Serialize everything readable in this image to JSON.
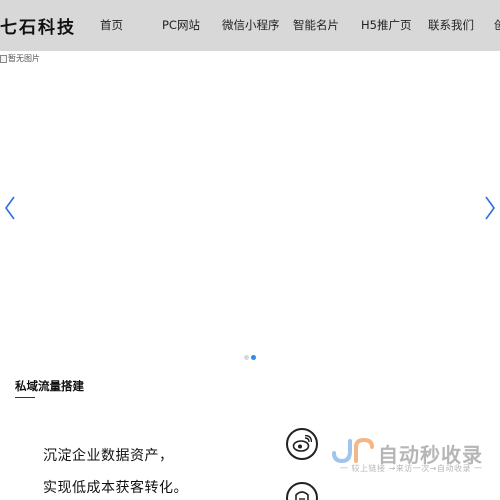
{
  "header": {
    "logo": "七石科技",
    "nav": [
      {
        "label": "首页"
      },
      {
        "label": "PC网站"
      },
      {
        "label": "微信小程序"
      },
      {
        "label": "智能名片"
      },
      {
        "label": "H5推广页"
      },
      {
        "label": "联系我们"
      },
      {
        "label": "创"
      }
    ]
  },
  "banner": {
    "image_alt": "暂无图片",
    "prev_icon": "chevron-left-icon",
    "next_icon": "chevron-right-icon",
    "dots": [
      {
        "active": false,
        "color": "#cfd8e3"
      },
      {
        "active": true,
        "color": "#2f8de4"
      }
    ]
  },
  "section": {
    "title": "私域流量搭建"
  },
  "slogan": {
    "lines": [
      "沉淀企业数据资产，",
      "实现低成本获客转化。"
    ]
  },
  "icons": [
    "weibo-icon",
    "round-badge-icon"
  ],
  "watermark": {
    "logo": "JR",
    "main": "自动秒收录",
    "sub": "一 较上链接 →来访一次→自动收录 一"
  },
  "colors": {
    "header_bg": "#d8d8d8",
    "accent": "#2f8de4"
  }
}
